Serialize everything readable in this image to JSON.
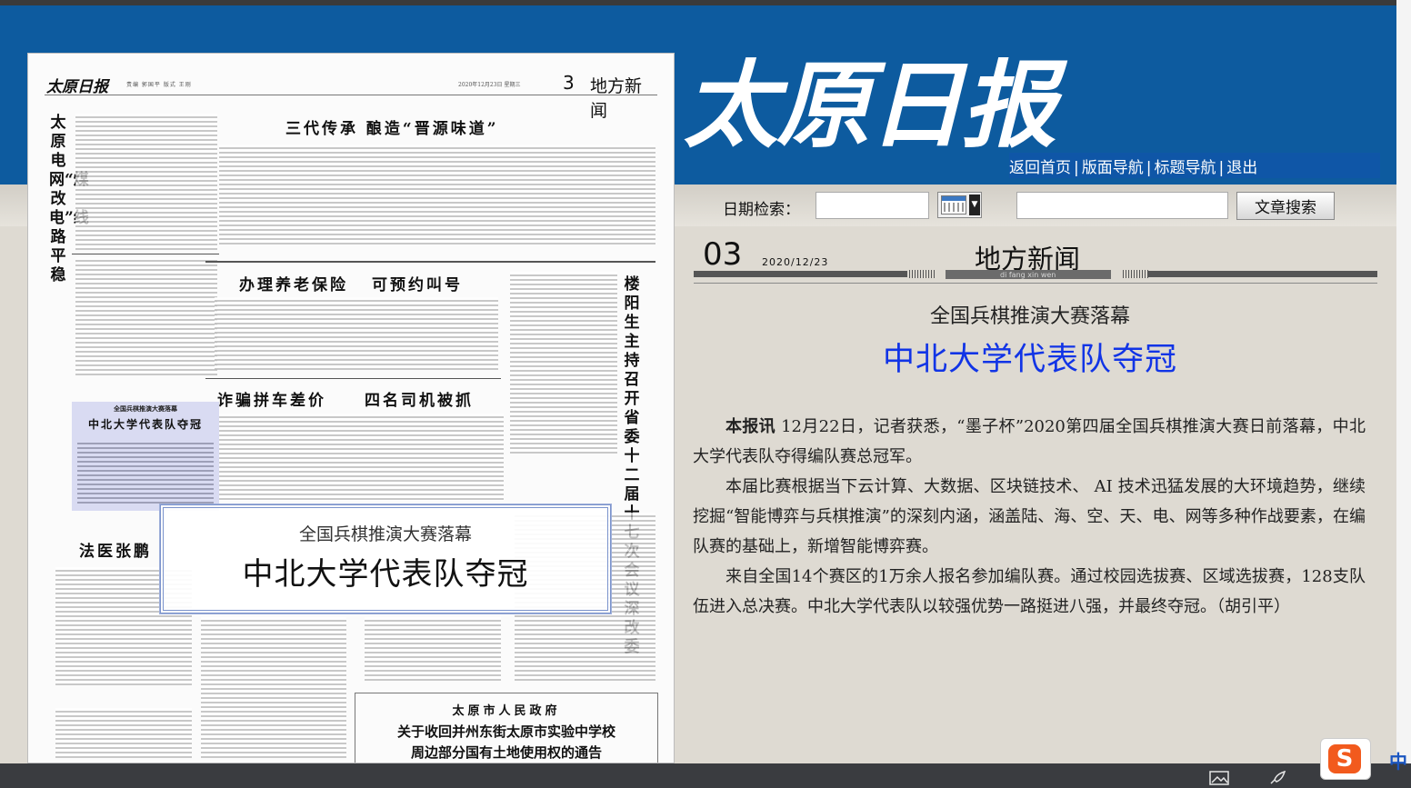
{
  "masthead": {
    "title": "太原日报"
  },
  "nav": {
    "items": [
      "返回首页",
      "版面导航",
      "标题导航",
      "退出"
    ],
    "separator": "|"
  },
  "search": {
    "date_label": "日期检索：",
    "date_value": "",
    "keyword_value": "",
    "button_label": "文章搜索"
  },
  "page_header": {
    "number": "03",
    "date": "2020/12/23",
    "section": "地方新闻",
    "pinyin": "di fang xin wen"
  },
  "article": {
    "subtitle": "全国兵棋推演大赛落幕",
    "title": "中北大学代表队夺冠",
    "lead_marker": "本报讯",
    "paragraphs": [
      "12月22日，记者获悉，“墨子杯”2020第四届全国兵棋推演大赛日前落幕，中北大学代表队夺得编队赛总冠军。",
      "本届比赛根据当下云计算、大数据、区块链技术、 AI 技术迅猛发展的大环境趋势，继续挖掘“智能博弈与兵棋推演”的深刻内涵，涵盖陆、海、空、天、电、网等多种作战要素，在编队赛的基础上，新增智能博弈赛。",
      "来自全国14个赛区的1万余人报名参加编队赛。通过校园选拔赛、区域选拔赛，128支队伍进入总决赛。中北大学代表队以较强优势一路挺进八强，并最终夺冠。（胡引平）"
    ]
  },
  "newspaper": {
    "logo": "太原日报",
    "header_meta": "责编  郭国平   版式  王刚",
    "header_date": "2020年12月23日  星期三",
    "page_num": "3",
    "page_section": "地方新闻",
    "vertical_left_title": "太原电网“煤改电”线路平稳",
    "top_headline": "三代传承  酿造“晋源味道”",
    "headline_left_1": "办理养老保险",
    "headline_right_1": "可预约叫号",
    "vertical_right_title": "楼阳生主持召开省委十二届十七次会议深改委",
    "headline_left_2": "诈骗拼车差价",
    "headline_right_2": "四名司机被抓",
    "small_box_kicker": "全国兵棋推演大赛落幕",
    "small_box_title": "中北大学代表队夺冠",
    "lower_headline": "法医张鹏",
    "notice_org": "太原市人民政府",
    "notice_title_1": "关于收回并州东街太原市实验中学校",
    "notice_title_2": "周边部分国有土地使用权的通告"
  },
  "highlight": {
    "subtitle": "全国兵棋推演大赛落幕",
    "title": "中北大学代表队夺冠"
  },
  "ime": {
    "badge": "S",
    "mode": "中"
  },
  "colors": {
    "header_blue": "#0d5b9f",
    "title_blue": "#1134e6",
    "panel_grey": "#dedad2"
  }
}
